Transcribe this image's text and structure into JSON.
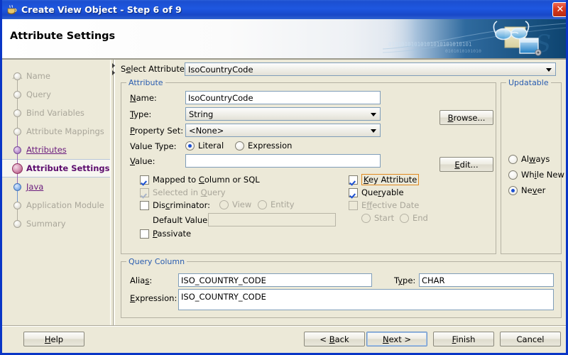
{
  "window": {
    "title_main": "Create View Object",
    "title_step": "- Step 6 of 9",
    "app_icon": "java-coffee-cup-icon",
    "close_label": "✕",
    "accent_border": "#0a36c6",
    "titlebar_color": "#1e57e0"
  },
  "header": {
    "title": "Attribute Settings",
    "banner_icon": "glasses-and-window-banner-icon",
    "binary_text": "01010101010101010101010101"
  },
  "sidebar": {
    "steps": [
      {
        "label": "Name",
        "state": "done"
      },
      {
        "label": "Query",
        "state": "done"
      },
      {
        "label": "Bind Variables",
        "state": "done"
      },
      {
        "label": "Attribute Mappings",
        "state": "done"
      },
      {
        "label": "Attributes",
        "state": "visited"
      },
      {
        "label": "Attribute Settings",
        "state": "current"
      },
      {
        "label": "Java",
        "state": "visited-blue"
      },
      {
        "label": "Application Module",
        "state": "pending"
      },
      {
        "label": "Summary",
        "state": "pending"
      }
    ]
  },
  "main": {
    "select_attribute": {
      "label": "Select Attribute:",
      "value": "IsoCountryCode"
    },
    "attribute_group": {
      "title": "Attribute",
      "name_label": "Name:",
      "name_value": "IsoCountryCode",
      "type_label": "Type:",
      "type_value": "String",
      "browse_label": "Browse...",
      "property_set_label": "Property Set:",
      "property_set_value": "<None>",
      "value_type_label": "Value Type:",
      "value_type_literal": "Literal",
      "value_type_expression": "Expression",
      "value_type_selected": "Literal",
      "value_label": "Value:",
      "value_value": "",
      "edit_label": "Edit...",
      "checks": {
        "mapped_to_column": {
          "label": "Mapped to Column or SQL",
          "checked": true,
          "enabled": true
        },
        "selected_in_query": {
          "label": "Selected in Query",
          "checked": true,
          "enabled": false
        },
        "discriminator": {
          "label": "Discriminator:",
          "checked": false,
          "enabled": true
        },
        "discriminator_view": {
          "label": "View",
          "selected": false,
          "enabled": false
        },
        "discriminator_entity": {
          "label": "Entity",
          "selected": false,
          "enabled": false
        },
        "default_value_label": "Default Value:",
        "default_value": "",
        "passivate": {
          "label": "Passivate",
          "checked": false,
          "enabled": true
        },
        "key_attribute": {
          "label": "Key Attribute",
          "checked": true,
          "enabled": true,
          "focused": true
        },
        "queryable": {
          "label": "Queryable",
          "checked": true,
          "enabled": true
        },
        "effective_date": {
          "label": "Effective Date",
          "checked": false,
          "enabled": false
        },
        "effective_start": {
          "label": "Start",
          "selected": false,
          "enabled": false
        },
        "effective_end": {
          "label": "End",
          "selected": false,
          "enabled": false
        }
      }
    },
    "updatable_group": {
      "title": "Updatable",
      "options": [
        {
          "label": "Always",
          "selected": false
        },
        {
          "label": "While New",
          "selected": false
        },
        {
          "label": "Never",
          "selected": true
        }
      ]
    },
    "query_column_group": {
      "title": "Query Column",
      "alias_label": "Alias:",
      "alias_value": "ISO_COUNTRY_CODE",
      "type_label": "Type:",
      "type_value": "CHAR",
      "expression_label": "Expression:",
      "expression_value": "ISO_COUNTRY_CODE"
    }
  },
  "buttonbar": {
    "help": "Help",
    "back": "< Back",
    "next": "Next >",
    "finish": "Finish",
    "cancel": "Cancel",
    "default_button": "Next >"
  }
}
